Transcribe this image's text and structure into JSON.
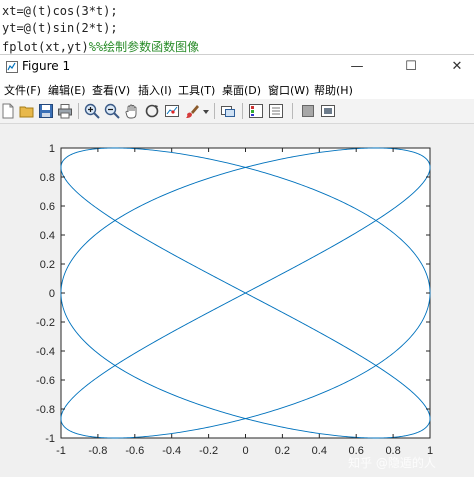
{
  "code": {
    "line1": "xt=@(t)cos(3*t);",
    "line2": "yt=@(t)sin(2*t);",
    "line3_code": "fplot(xt,yt)",
    "line3_comment": "%%绘制参数函数图像"
  },
  "window": {
    "title": "Figure 1",
    "minimize": "—",
    "maximize": "☐",
    "close": "✕"
  },
  "menu": [
    "文件(F)",
    "编辑(E)",
    "查看(V)",
    "插入(I)",
    "工具(T)",
    "桌面(D)",
    "窗口(W)",
    "帮助(H)"
  ],
  "toolbar": {
    "icons": [
      "new-figure-icon",
      "open-file-icon",
      "save-icon",
      "print-icon",
      "zoom-in-icon",
      "zoom-out-icon",
      "pan-hand-icon",
      "rotate-3d-icon",
      "data-cursor-icon",
      "brush-icon",
      "link-plot-icon",
      "insert-colorbar-icon",
      "insert-legend-icon",
      "hide-plot-tools-icon",
      "show-plot-tools-icon"
    ]
  },
  "watermark": "知乎 @隐遁的人",
  "chart_data": {
    "type": "line",
    "series_color": "#0072bd",
    "curve": {
      "x_expr": "cos(3*t)",
      "y_expr": "sin(2*t)",
      "t_range": [
        -5,
        5
      ]
    },
    "xlim": [
      -1,
      1
    ],
    "ylim": [
      -1,
      1
    ],
    "x_ticks": [
      "-1",
      "-0.8",
      "-0.6",
      "-0.4",
      "-0.2",
      "0",
      "0.2",
      "0.4",
      "0.6",
      "0.8",
      "1"
    ],
    "y_ticks": [
      "1",
      "0.8",
      "0.6",
      "0.4",
      "0.2",
      "0",
      "-0.2",
      "-0.4",
      "-0.6",
      "-0.8",
      "-1"
    ],
    "grid": false
  }
}
